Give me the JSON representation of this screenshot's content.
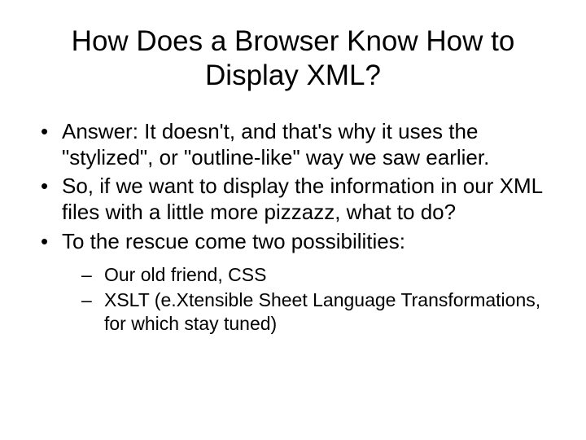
{
  "title": "How Does a Browser Know How to Display XML?",
  "bullets": [
    "Answer: It doesn't, and that's why it uses the \"stylized\", or \"outline-like\" way we saw earlier.",
    "So, if we want to display the information in our XML files with a little more pizzazz, what to do?",
    "To the rescue come two possibilities:"
  ],
  "subBullets": [
    "Our old friend, CSS",
    "XSLT (e.Xtensible Sheet Language Transformations, for which stay tuned)"
  ]
}
